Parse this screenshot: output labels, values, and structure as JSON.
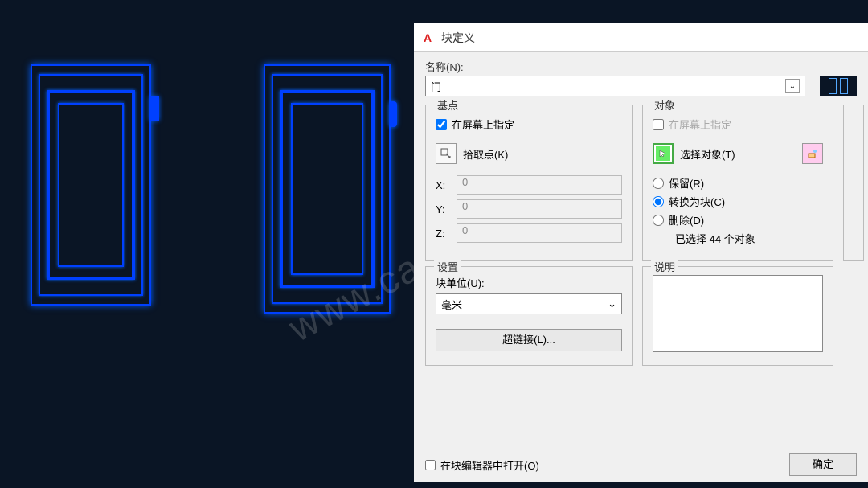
{
  "dialog": {
    "title": "块定义",
    "name_label": "名称(N):",
    "name_value": "门",
    "basepoint": {
      "title": "基点",
      "on_screen": "在屏幕上指定",
      "on_screen_checked": true,
      "pick": "拾取点(K)",
      "x_label": "X:",
      "y_label": "Y:",
      "z_label": "Z:",
      "x": "0",
      "y": "0",
      "z": "0"
    },
    "objects": {
      "title": "对象",
      "on_screen": "在屏幕上指定",
      "on_screen_checked": false,
      "select": "选择对象(T)",
      "retain": "保留(R)",
      "convert": "转换为块(C)",
      "delete": "删除(D)",
      "selected_count": "已选择 44 个对象"
    },
    "settings": {
      "title": "设置",
      "unit_label": "块单位(U):",
      "unit_value": "毫米",
      "hyperlink": "超链接(L)..."
    },
    "description": {
      "title": "说明"
    },
    "open_in_editor": "在块编辑器中打开(O)",
    "ok": "确定"
  }
}
